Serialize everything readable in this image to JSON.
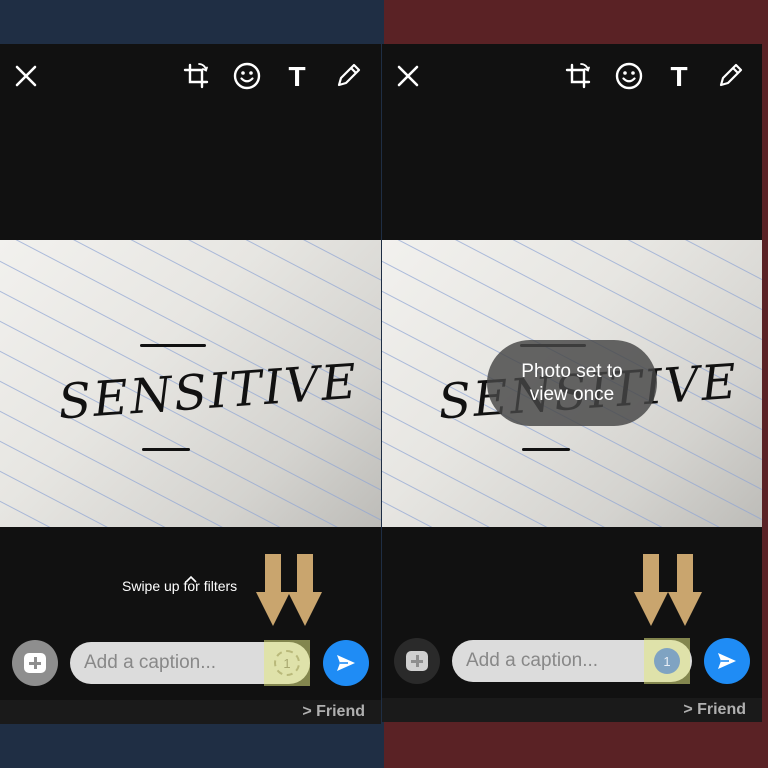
{
  "colors": {
    "left_background": "#1f2e44",
    "right_background": "#5a2225",
    "send_button": "#1f8cf5",
    "highlight": "#e2e882",
    "arrow": "#c9a56e"
  },
  "left": {
    "toolbar": {
      "close": "close-icon",
      "crop": "crop-rotate-icon",
      "emoji": "emoji-icon",
      "text": "T",
      "draw": "pencil-icon"
    },
    "photo_text": "SENSITIVE",
    "swipe_hint": "Swipe up for filters",
    "caption_placeholder": "Add a caption...",
    "view_once_glyph": "1",
    "recipient": "> Friend"
  },
  "right": {
    "toolbar": {
      "close": "close-icon",
      "crop": "crop-rotate-icon",
      "emoji": "emoji-icon",
      "text": "T",
      "draw": "pencil-icon"
    },
    "photo_text": "SENSITIVE",
    "toast": "Photo set to view once",
    "caption_placeholder": "Add a caption...",
    "view_once_glyph": "1",
    "recipient": "> Friend"
  }
}
